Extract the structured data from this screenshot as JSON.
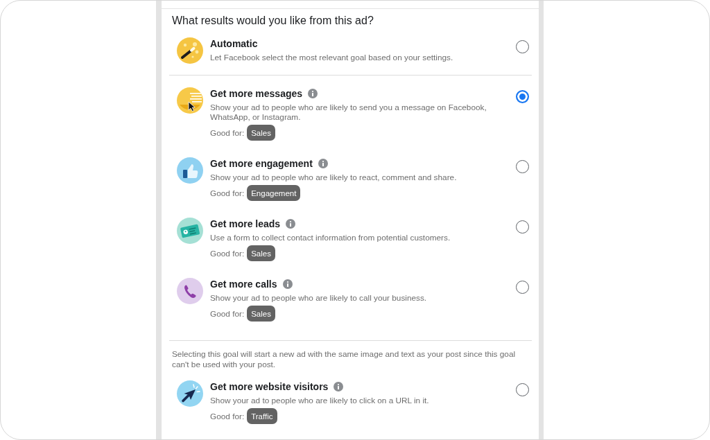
{
  "heading": "What results would you like from this ad?",
  "groups": [
    {
      "options": [
        {
          "kind": "automatic",
          "title": "Automatic",
          "description": "Let Facebook select the most relevant goal based on your settings.",
          "selected": false
        }
      ]
    },
    {
      "options": [
        {
          "kind": "goal",
          "title": "Get more messages",
          "description": "Show your ad to people who are likely to send you a message on Facebook, WhatsApp, or Instagram.",
          "good_for": {
            "label": "Good for:",
            "tag": "Sales"
          },
          "selected": true
        },
        {
          "kind": "goal",
          "title": "Get more engagement",
          "description": "Show your ad to people who are likely to react, comment and share.",
          "good_for": {
            "label": "Good for:",
            "tag": "Engagement"
          },
          "selected": false
        },
        {
          "kind": "goal",
          "title": "Get more leads",
          "description": "Use a form to collect contact information from potential customers.",
          "good_for": {
            "label": "Good for:",
            "tag": "Sales"
          },
          "selected": false
        },
        {
          "kind": "goal",
          "title": "Get more calls",
          "description": "Show your ad to people who are likely to call your business.",
          "good_for": {
            "label": "Good for:",
            "tag": "Sales"
          },
          "selected": false
        }
      ]
    },
    {
      "note": "Selecting this goal will start a new ad with the same image and text as your post since this goal can't be used with your post.",
      "options": [
        {
          "kind": "goal",
          "title": "Get more website visitors",
          "description": "Show your ad to people who are likely to click on a URL in it.",
          "good_for": {
            "label": "Good for:",
            "tag": "Traffic"
          },
          "selected": false
        }
      ]
    }
  ]
}
